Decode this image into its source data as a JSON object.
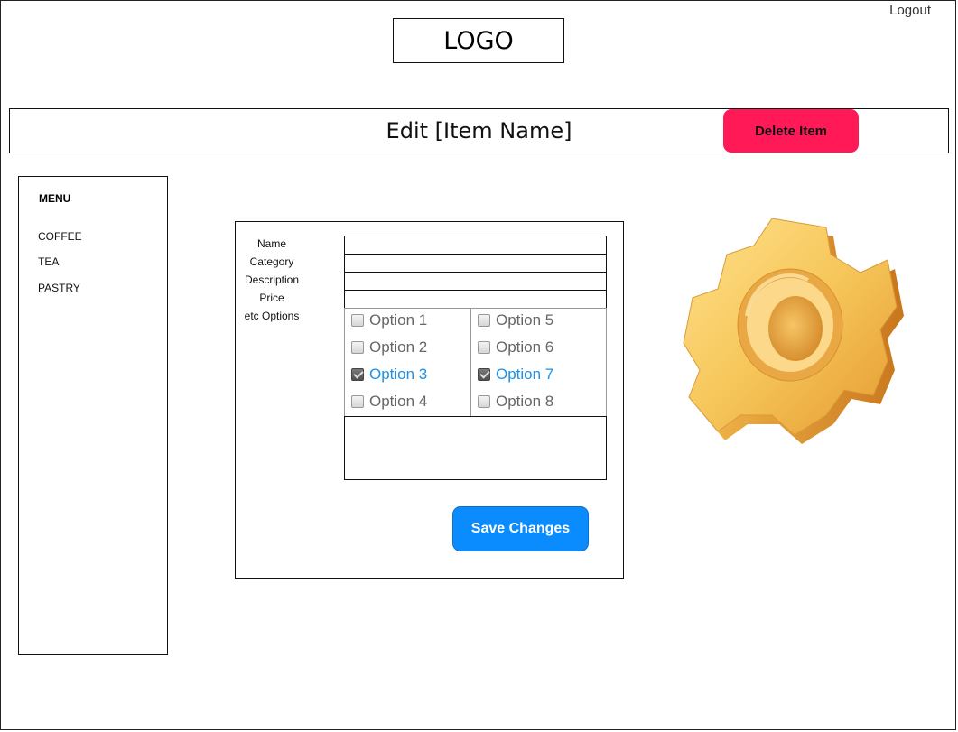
{
  "header": {
    "logout_label": "Logout",
    "logo_text": "LOGO",
    "page_title": "Edit [Item Name]",
    "delete_label": "Delete Item"
  },
  "sidebar": {
    "title": "MENU",
    "items": [
      {
        "label": "COFFEE"
      },
      {
        "label": "TEA"
      },
      {
        "label": "PASTRY"
      }
    ]
  },
  "form": {
    "fields": [
      {
        "label": "Name",
        "value": ""
      },
      {
        "label": "Category",
        "value": ""
      },
      {
        "label": "Description",
        "value": ""
      },
      {
        "label": "Price",
        "value": ""
      }
    ],
    "options_label": "etc Options",
    "options": [
      {
        "label": "Option 1",
        "checked": false
      },
      {
        "label": "Option 2",
        "checked": false
      },
      {
        "label": "Option 3",
        "checked": true
      },
      {
        "label": "Option 4",
        "checked": false
      },
      {
        "label": "Option 5",
        "checked": false
      },
      {
        "label": "Option 6",
        "checked": false
      },
      {
        "label": "Option 7",
        "checked": true
      },
      {
        "label": "Option 8",
        "checked": false
      }
    ],
    "notes_value": "",
    "save_label": "Save Changes"
  },
  "colors": {
    "delete_button": "#ff1a57",
    "save_button": "#0a8cff",
    "checked_option": "#1e90e6",
    "gear": "#f2b640"
  },
  "icons": {
    "gear": "gear-icon"
  }
}
